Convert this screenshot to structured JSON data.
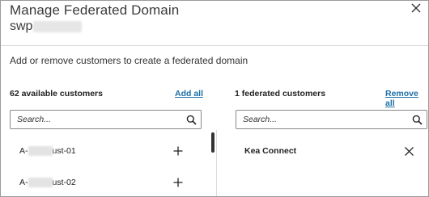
{
  "dialog": {
    "title": "Manage Federated Domain",
    "subtitle_prefix": "swp",
    "description": "Add or remove customers to create a federated domain"
  },
  "available": {
    "heading": "62 available customers",
    "add_all_label": "Add all",
    "search_placeholder": "Search...",
    "items": [
      {
        "prefix": "A-",
        "suffix": "ust-01",
        "action_icon": "plus-icon"
      },
      {
        "prefix": "A-",
        "suffix": "ust-02",
        "action_icon": "plus-icon"
      }
    ]
  },
  "federated": {
    "heading": "1 federated customers",
    "remove_all_label": "Remove all",
    "search_placeholder": "Search...",
    "items": [
      {
        "name": "Kea Connect",
        "action_icon": "close-icon"
      }
    ]
  },
  "colors": {
    "link": "#1d6fa5",
    "border": "#9a9a9a"
  }
}
